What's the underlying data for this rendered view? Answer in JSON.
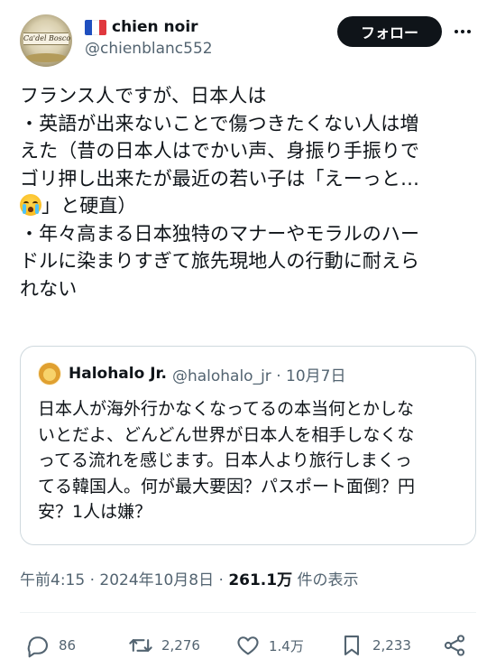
{
  "author": {
    "display_name": "chien noir",
    "handle": "@chienblanc552",
    "flag_icon": "france-flag-icon",
    "avatar_text": "Ca'del Bosco"
  },
  "header": {
    "follow_label": "フォロー",
    "more_icon": "more-options-icon"
  },
  "tweet": {
    "lines": [
      "フランス人ですが、日本人は",
      "・英語が出来ないことで傷つきたくない人は増",
      "えた（昔の日本人はでかい声、身振り手振りで",
      "ゴリ押し出来たが最近の若い子は「えーっと…",
      "」と硬直）",
      "・年々高まる日本独特のマナーやモラルのハー",
      "ドルに染まりすぎて旅先現地人の行動に耐えら",
      "れない"
    ],
    "emoji_icon": "crying-face-emoji"
  },
  "quote": {
    "display_name": "Halohalo Jr.",
    "handle_date": "@halohalo_jr · 10月7日",
    "lines": [
      "日本人が海外行かなくなってるの本当何とかしな",
      "いとだよ、どんどん世界が日本人を相手しなくな",
      "ってる流れを感じます。日本人より旅行しまくっ",
      "てる韓国人。何が最大要因？パスポート面倒？円",
      "安？1人は嫌？"
    ]
  },
  "meta": {
    "time_date": "午前4:15 · 2024年10月8日 · ",
    "views": "261.1万",
    "views_suffix": " 件の表示"
  },
  "actions": {
    "replies": "86",
    "reposts": "2,276",
    "likes": "1.4万",
    "bookmarks": "2,233"
  },
  "colors": {
    "text": "#0f1419",
    "secondary": "#536471",
    "border": "#cfd9de",
    "button_bg": "#0f1419"
  }
}
